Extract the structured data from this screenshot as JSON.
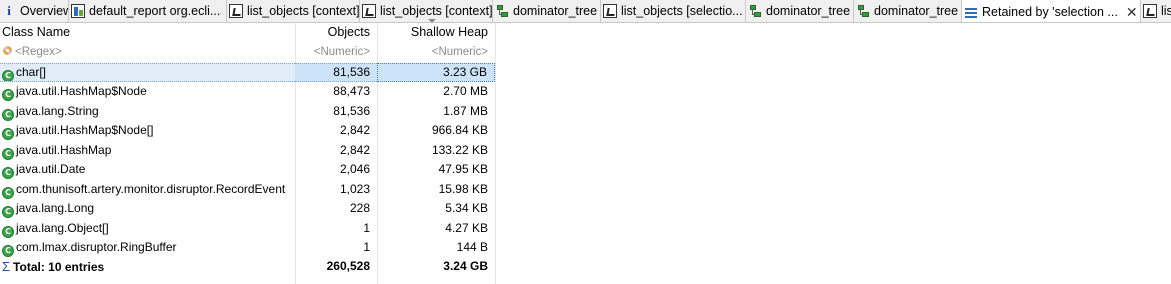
{
  "tabs": [
    {
      "label": "Overview",
      "icon": "info-icon",
      "active": false
    },
    {
      "label": "default_report org.ecli...",
      "icon": "report-icon",
      "active": false
    },
    {
      "label": "list_objects [context]",
      "icon": "list-objects-icon",
      "active": false
    },
    {
      "label": "list_objects [context]",
      "icon": "list-objects-icon",
      "active": false
    },
    {
      "label": "dominator_tree",
      "icon": "dominator-tree-icon",
      "active": false
    },
    {
      "label": "list_objects [selectio...",
      "icon": "list-objects-icon",
      "active": false
    },
    {
      "label": "dominator_tree",
      "icon": "dominator-tree-icon",
      "active": false
    },
    {
      "label": "dominator_tree",
      "icon": "dominator-tree-icon",
      "active": false
    },
    {
      "label": "Retained by 'selection ...",
      "icon": "retained-set-icon",
      "active": true,
      "close": "✕"
    },
    {
      "label": "lis",
      "icon": "list-objects-icon",
      "active": false
    }
  ],
  "table": {
    "columns": [
      "Class Name",
      "Objects",
      "Shallow Heap"
    ],
    "filters": [
      "<Regex>",
      "<Numeric>",
      "<Numeric>"
    ],
    "rows": [
      {
        "name": "char[]",
        "objects": "81,536",
        "shallow_heap": "3.23 GB",
        "selected": true
      },
      {
        "name": "java.util.HashMap$Node",
        "objects": "88,473",
        "shallow_heap": "2.70 MB"
      },
      {
        "name": "java.lang.String",
        "objects": "81,536",
        "shallow_heap": "1.87 MB"
      },
      {
        "name": "java.util.HashMap$Node[]",
        "objects": "2,842",
        "shallow_heap": "966.84 KB"
      },
      {
        "name": "java.util.HashMap",
        "objects": "2,842",
        "shallow_heap": "133.22 KB"
      },
      {
        "name": "java.util.Date",
        "objects": "2,046",
        "shallow_heap": "47.95 KB"
      },
      {
        "name": "com.thunisoft.artery.monitor.disruptor.RecordEvent",
        "objects": "1,023",
        "shallow_heap": "15.98 KB"
      },
      {
        "name": "java.lang.Long",
        "objects": "228",
        "shallow_heap": "5.34 KB"
      },
      {
        "name": "java.lang.Object[]",
        "objects": "1",
        "shallow_heap": "4.27 KB"
      },
      {
        "name": "com.lmax.disruptor.RingBuffer",
        "objects": "1",
        "shallow_heap": "144 B"
      }
    ],
    "total": {
      "sigma": "Σ",
      "label": "Total: 10 entries",
      "objects": "260,528",
      "shallow_heap": "3.24 GB"
    },
    "class_icon_glyph": "C"
  },
  "colors": {
    "selection": "#cde3f7",
    "class_icon": "#3aa54a",
    "tabbar": "#f0f0f0"
  }
}
